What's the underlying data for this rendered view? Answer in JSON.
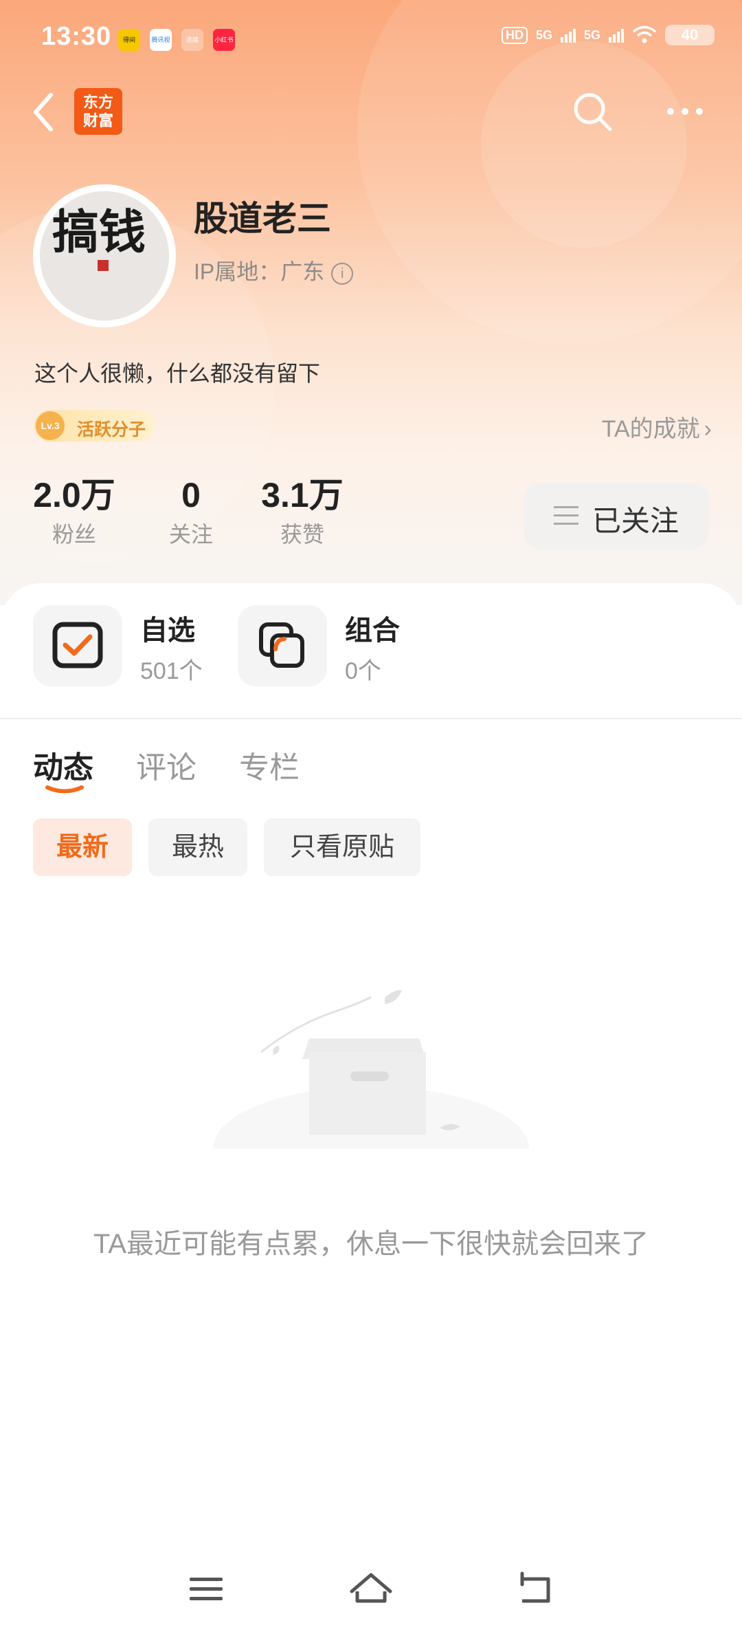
{
  "status_bar": {
    "time": "13:30",
    "notification_apps": [
      "得间",
      "腾讯视频",
      "连接",
      "小红书"
    ],
    "hd_label": "HD",
    "network_1": "5G",
    "network_2": "5G",
    "battery": "40"
  },
  "header": {
    "logo_line1": "东方",
    "logo_line2": "财富"
  },
  "profile": {
    "name": "股道老三",
    "ip_location": "IP属地：广东",
    "bio": "这个人很懒，什么都没有留下",
    "badge_level": "Lv.3",
    "badge_title": "活跃分子",
    "achievements_link": "TA的成就",
    "avatar_text_main": "搞钱",
    "stats": [
      {
        "value": "2.0万",
        "label": "粉丝"
      },
      {
        "value": "0",
        "label": "关注"
      },
      {
        "value": "3.1万",
        "label": "获赞"
      }
    ],
    "follow_button": "已关注"
  },
  "modules": [
    {
      "title": "自选",
      "subtitle": "501个"
    },
    {
      "title": "组合",
      "subtitle": "0个"
    }
  ],
  "tabs": [
    "动态",
    "评论",
    "专栏"
  ],
  "filters": [
    "最新",
    "最热",
    "只看原贴"
  ],
  "empty_state": {
    "message": "TA最近可能有点累，休息一下很快就会回来了"
  },
  "colors": {
    "accent": "#f26a1b",
    "logo_bg": "#f25a16"
  }
}
